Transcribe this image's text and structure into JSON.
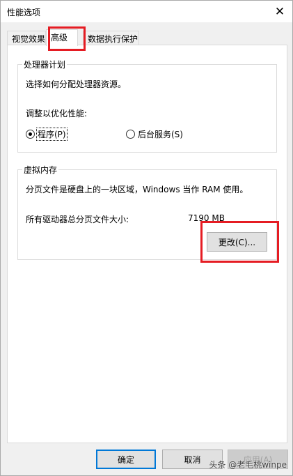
{
  "window": {
    "title": "性能选项",
    "close_glyph": "✕"
  },
  "tabs": [
    {
      "label": "视觉效果",
      "active": false
    },
    {
      "label": "高级",
      "active": true
    },
    {
      "label": "数据执行保护",
      "active": false
    }
  ],
  "processor": {
    "group_title": "处理器计划",
    "description": "选择如何分配处理器资源。",
    "adjust_label": "调整以优化性能:",
    "options": [
      {
        "label": "程序(P)",
        "selected": true
      },
      {
        "label": "后台服务(S)",
        "selected": false
      }
    ]
  },
  "virtual_memory": {
    "group_title": "虚拟内存",
    "description": "分页文件是硬盘上的一块区域，Windows 当作 RAM 使用。",
    "total_label": "所有驱动器总分页文件大小:",
    "total_value": "7190 MB",
    "change_button": "更改(C)..."
  },
  "footer": {
    "ok": "确定",
    "cancel": "取消",
    "apply": "应用(A)"
  },
  "watermark": "头条 @老毛桃winpe",
  "highlight_color": "#e51c23"
}
